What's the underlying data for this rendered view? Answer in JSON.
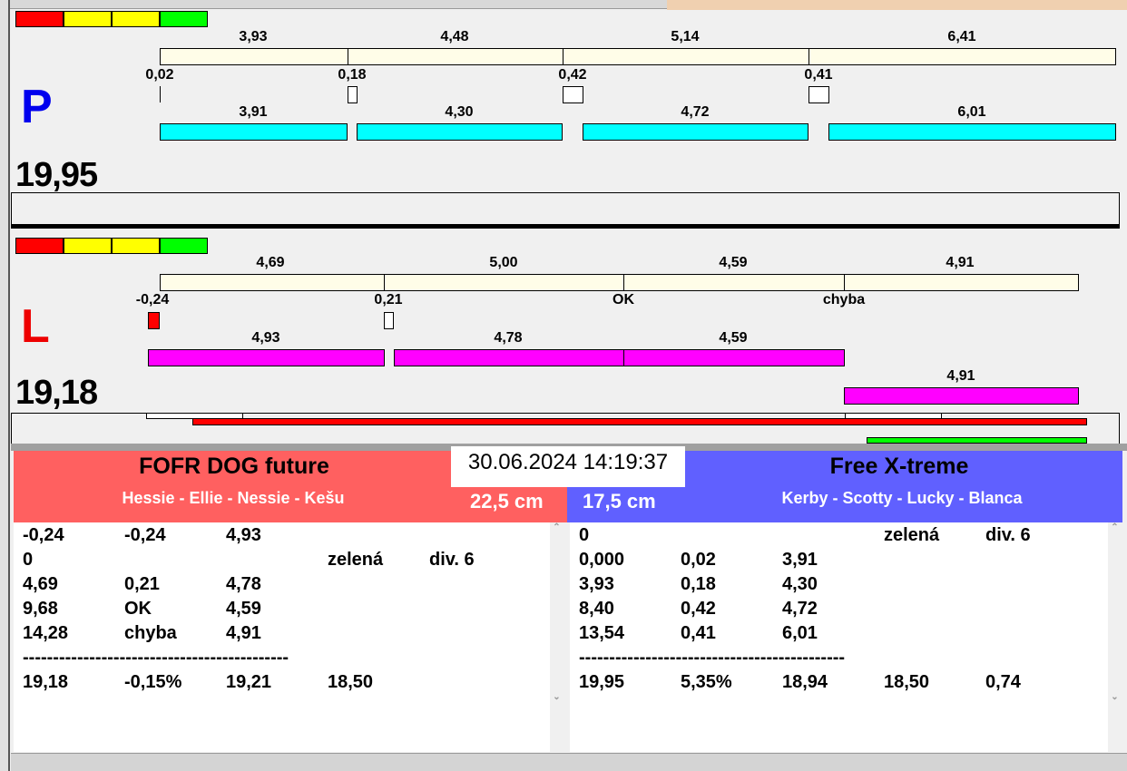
{
  "colors": {
    "red": "#ff0000",
    "yellow": "#ffff00",
    "green": "#00ff00",
    "cyan": "#00ffff",
    "magenta": "#ff00ff",
    "team_left": "#ff6060",
    "team_right": "#6060ff"
  },
  "P": {
    "letter": "P",
    "total": "19,95",
    "top": [
      "3,93",
      "4,48",
      "5,14",
      "6,41"
    ],
    "diffs": [
      "0,02",
      "0,18",
      "0,42",
      "0,41"
    ],
    "bars": [
      "3,91",
      "4,30",
      "4,72",
      "6,01"
    ]
  },
  "L": {
    "letter": "L",
    "total": "19,18",
    "top": [
      "4,69",
      "5,00",
      "4,59",
      "4,91"
    ],
    "diffs": [
      "-0,24",
      "0,21",
      "OK",
      "chyba"
    ],
    "bars": [
      "4,93",
      "4,78",
      "4,59",
      "4,91"
    ]
  },
  "datetime": "30.06.2024 14:19:37",
  "left_team": {
    "name": "FOFR DOG future",
    "dogs": "Hessie - Ellie - Nessie - Kešu",
    "height": "22,5 cm",
    "rows": [
      [
        "-0,24",
        "-0,24",
        "4,93",
        "",
        ""
      ],
      [
        "0",
        "",
        "",
        "zelená",
        "div. 6"
      ],
      [
        "4,69",
        "0,21",
        "4,78",
        "",
        ""
      ],
      [
        "9,68",
        "OK",
        "4,59",
        "",
        ""
      ],
      [
        "14,28",
        "chyba",
        "4,91",
        "",
        ""
      ]
    ],
    "separator": "--------------------------------------------",
    "summary": [
      "19,18",
      "-0,15%",
      "19,21",
      "18,50",
      ""
    ]
  },
  "right_team": {
    "name": "Free X-treme",
    "dogs": "Kerby - Scotty - Lucky - Blanca",
    "height": "17,5 cm",
    "rows": [
      [
        "0",
        "",
        "",
        "zelená",
        "div. 6"
      ],
      [
        "0,000",
        "0,02",
        "3,91",
        "",
        ""
      ],
      [
        "3,93",
        "0,18",
        "4,30",
        "",
        ""
      ],
      [
        "8,40",
        "0,42",
        "4,72",
        "",
        ""
      ],
      [
        "13,54",
        "0,41",
        "6,01",
        "",
        ""
      ]
    ],
    "separator": "--------------------------------------------",
    "summary": [
      "19,95",
      "5,35%",
      "18,94",
      "18,50",
      "0,74"
    ]
  }
}
